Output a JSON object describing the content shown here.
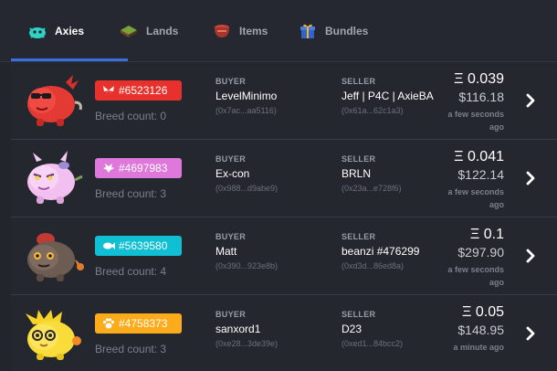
{
  "tabs": [
    {
      "label": "Axies",
      "icon": "axie-icon",
      "active": true
    },
    {
      "label": "Lands",
      "icon": "land-icon",
      "active": false
    },
    {
      "label": "Items",
      "icon": "item-pot-icon",
      "active": false
    },
    {
      "label": "Bundles",
      "icon": "gift-box-icon",
      "active": false
    }
  ],
  "colors": {
    "accent": "#3a6fe2",
    "beast": "#e8312c",
    "bug": "#df78db",
    "aquatic": "#10bfd4",
    "plant": "#fcab1b"
  },
  "labels": {
    "buyer": "BUYER",
    "seller": "SELLER"
  },
  "sales": [
    {
      "axie_id": "#6523126",
      "class": "bug",
      "class_color": "#e8312c",
      "class_icon": "butterfly-icon",
      "breed_count": "Breed count: 0",
      "buyer_name": "LevelMinimo",
      "buyer_addr": "(0x7ac...aa5116)",
      "seller_name": "Jeff | P4C | AxieBA",
      "seller_addr": "(0x61a...62c1a3)",
      "eth": "Ξ 0.039",
      "usd": "$116.18",
      "time": "a few seconds ago"
    },
    {
      "axie_id": "#4697983",
      "class": "bird",
      "class_color": "#df78db",
      "class_icon": "bird-icon",
      "breed_count": "Breed count: 3",
      "buyer_name": "Ex-con",
      "buyer_addr": "(0x988...d9abe9)",
      "seller_name": "BRLN",
      "seller_addr": "(0x23a...e728f6)",
      "eth": "Ξ 0.041",
      "usd": "$122.14",
      "time": "a few seconds ago"
    },
    {
      "axie_id": "#5639580",
      "class": "aquatic",
      "class_color": "#10bfd4",
      "class_icon": "fish-icon",
      "breed_count": "Breed count: 4",
      "buyer_name": "Matt",
      "buyer_addr": "(0x390...923e8b)",
      "seller_name": "beanzi #476299",
      "seller_addr": "(0xd3d...86ed8a)",
      "eth": "Ξ 0.1",
      "usd": "$297.90",
      "time": "a few seconds ago"
    },
    {
      "axie_id": "#4758373",
      "class": "beast",
      "class_color": "#fcab1b",
      "class_icon": "paw-icon",
      "breed_count": "Breed count: 3",
      "buyer_name": "sanxord1",
      "buyer_addr": "(0xe28...3de39e)",
      "seller_name": "D23",
      "seller_addr": "(0xed1...84bcc2)",
      "eth": "Ξ 0.05",
      "usd": "$148.95",
      "time": "a minute ago"
    }
  ]
}
